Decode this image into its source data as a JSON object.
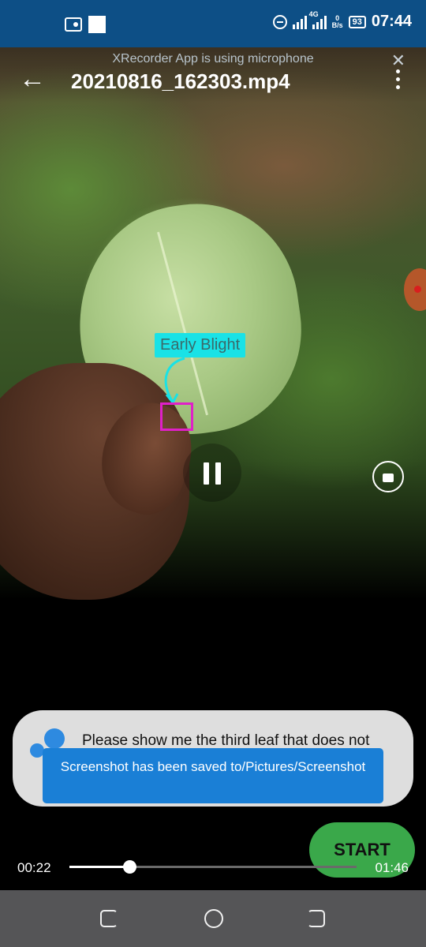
{
  "status_bar": {
    "network_type": "4G",
    "net_speed_value": "0",
    "net_speed_unit": "B/s",
    "battery": "93",
    "time": "07:44",
    "icons": [
      "radio-icon",
      "square-icon",
      "dnd-icon",
      "signal-icon",
      "battery-icon"
    ]
  },
  "notification": {
    "text": "XRecorder App is using microphone"
  },
  "header": {
    "file_name": "20210816_162303.mp4"
  },
  "detection": {
    "label": "Early Blight",
    "box_color": "#e020c8",
    "label_color": "#19e2e6"
  },
  "chat": {
    "message": "Please show me the third leaf that does not look healthy. Press start when the leaf is in focus."
  },
  "toast": {
    "text": "Screenshot has been saved to/Pictures/Screenshot"
  },
  "start_button": {
    "label": "START",
    "color": "#3aa84a"
  },
  "playback": {
    "current_time": "00:22",
    "total_time": "01:46",
    "progress": 0.21
  },
  "colors": {
    "status_bar": "#0d4f86",
    "accent": "#1a7fd6"
  }
}
